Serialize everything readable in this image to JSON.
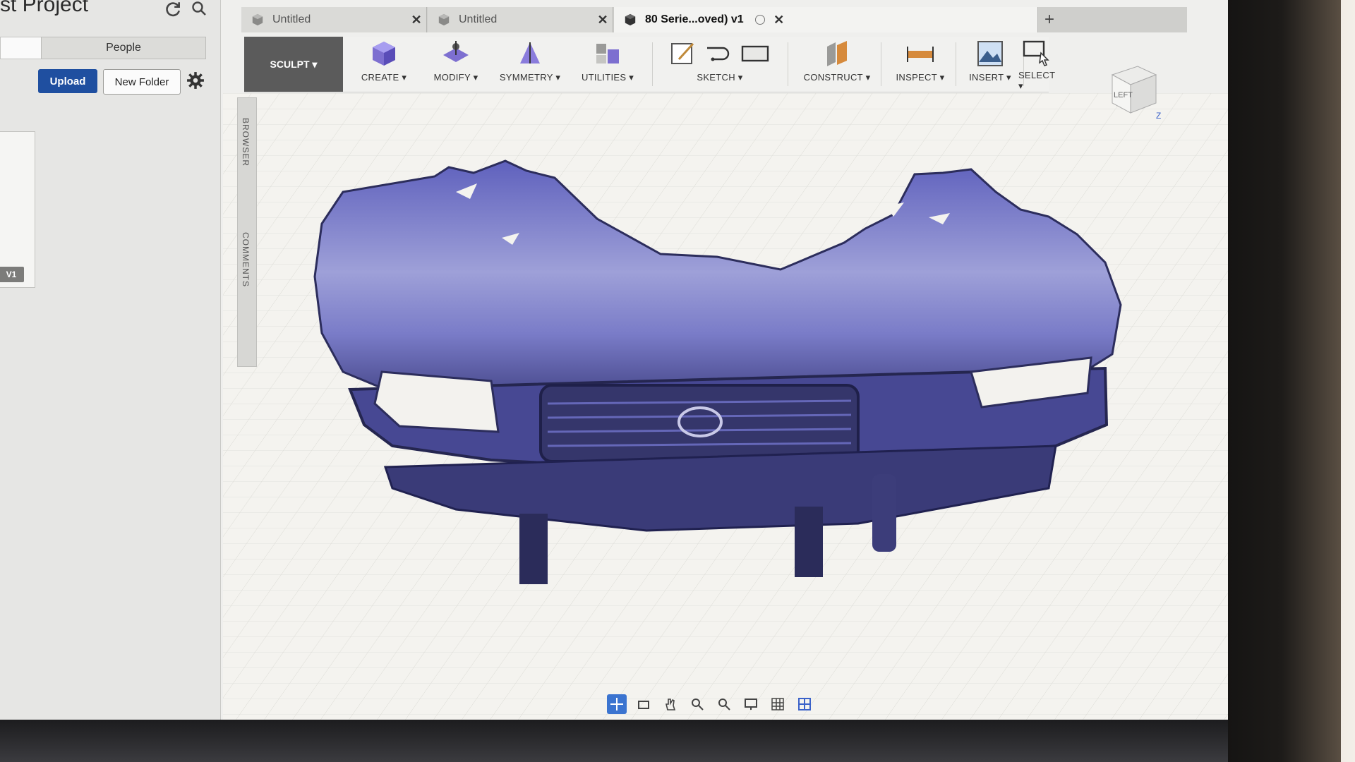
{
  "project": {
    "title": "rst Project"
  },
  "data_panel": {
    "tabs": [
      "",
      "People"
    ],
    "upload_label": "Upload",
    "new_folder_label": "New Folder",
    "version_badge": "V1"
  },
  "document_tabs": [
    {
      "label": "Untitled",
      "close": "✕"
    },
    {
      "label": "Untitled",
      "close": "✕"
    },
    {
      "label": "80 Serie...oved) v1",
      "close": "✕"
    }
  ],
  "new_tab_label": "+",
  "toolbar": {
    "workspace": "SCULPT ▾",
    "groups": [
      "CREATE ▾",
      "MODIFY ▾",
      "SYMMETRY ▾",
      "UTILITIES ▾",
      "SKETCH ▾",
      "CONSTRUCT ▾",
      "INSPECT ▾",
      "INSERT ▾",
      "SELECT ▾"
    ]
  },
  "side_panels": {
    "browser": "BROWSER",
    "comments": "COMMENTS"
  },
  "view_cube": {
    "face": "LEFT",
    "axis": "Z"
  },
  "colors": {
    "accent": "#1f4fa0",
    "mesh": "#6d6fc2",
    "nav_active": "#3b74d0"
  }
}
